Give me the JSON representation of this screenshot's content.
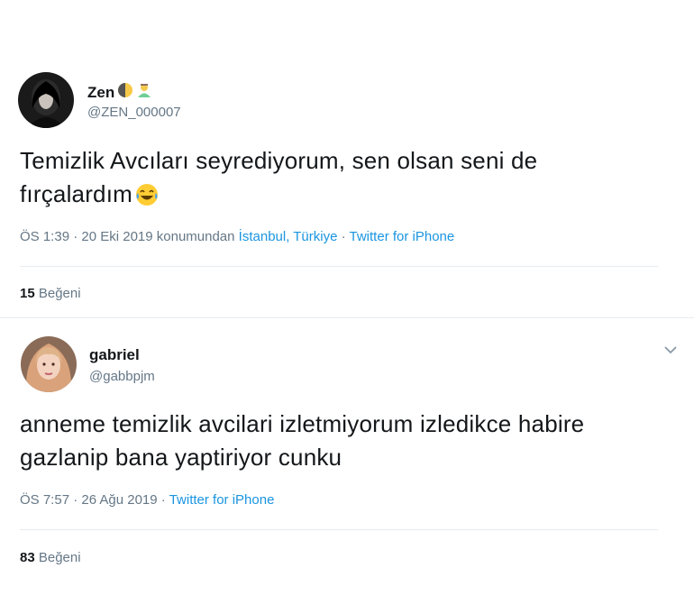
{
  "tweet1": {
    "display_name": "Zen",
    "name_emoji_1": "moon-icon",
    "name_emoji_2": "person-icon",
    "handle": "@ZEN_000007",
    "text_line1": "Temizlik Avcıları seyrediyorum, sen olsan seni de",
    "text_line2": "fırçalardım",
    "text_emoji": "laughing-crying-icon",
    "time": "ÖS 1:39 · 20 Eki 2019 konumundan ",
    "location": "İstanbul, Türkiye",
    "sep": " · ",
    "source": "Twitter for iPhone",
    "likes_count": "15",
    "likes_label": "Beğeni"
  },
  "tweet2": {
    "display_name": "gabriel",
    "handle": "@gabbpjm",
    "text_line1": "anneme temizlik avcilari izletmiyorum izledikce habire",
    "text_line2": "gazlanip bana yaptiriyor cunku",
    "time": "ÖS 7:57 · 26 Ağu 2019 · ",
    "source": "Twitter for iPhone",
    "likes_count": "83",
    "likes_label": "Beğeni"
  },
  "colors": {
    "link": "#1b95e0",
    "muted": "#657786",
    "text": "#14171a"
  }
}
